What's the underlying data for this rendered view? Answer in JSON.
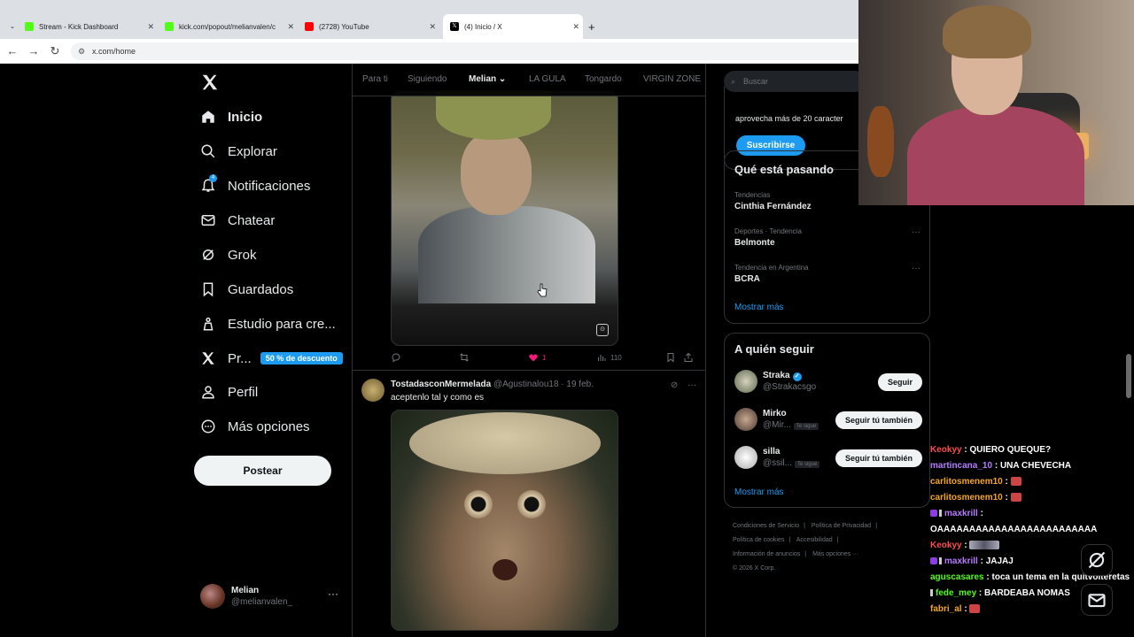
{
  "browser": {
    "tabs": [
      {
        "title": "Stream - Kick Dashboard",
        "color": "#53fc18"
      },
      {
        "title": "kick.com/popout/melianvalen/c",
        "color": "#53fc18"
      },
      {
        "title": "(2728) YouTube",
        "color": "#ff0000"
      },
      {
        "title": "(4) Inicio / X",
        "color": "#000000"
      }
    ],
    "new_tab": "+",
    "url": "x.com/home"
  },
  "nav": {
    "items": [
      {
        "label": "Inicio",
        "icon": "home-icon"
      },
      {
        "label": "Explorar",
        "icon": "search-icon"
      },
      {
        "label": "Notificaciones",
        "icon": "bell-icon",
        "badge": "4"
      },
      {
        "label": "Chatear",
        "icon": "mail-icon"
      },
      {
        "label": "Grok",
        "icon": "grok-icon"
      },
      {
        "label": "Guardados",
        "icon": "bookmark-icon"
      },
      {
        "label": "Estudio para cre...",
        "icon": "studio-icon"
      },
      {
        "label": "Pr...",
        "icon": "x-icon",
        "promo": "50 % de descuento"
      },
      {
        "label": "Perfil",
        "icon": "person-icon"
      },
      {
        "label": "Más opciones",
        "icon": "more-circle-icon"
      }
    ],
    "post_button": "Postear",
    "account": {
      "name": "Melian",
      "handle": "@melianvalen_",
      "more": "···"
    }
  },
  "feed": {
    "tabs": [
      "Para ti",
      "Siguiendo",
      "Melian",
      "LA GULA",
      "Tongardo",
      "VIRGIN ZONE"
    ],
    "selected_tab": "Melian",
    "tweet1": {
      "likes": "1",
      "views": "110",
      "gif_label": "GIF"
    },
    "tweet2": {
      "name": "TostadasconMermelada",
      "handle": "@Agustinalou18",
      "date": "· 19 feb.",
      "text": "aceptenlo tal y como es",
      "more": "···"
    }
  },
  "right": {
    "search_placeholder": "Buscar",
    "premium_text": "aprovecha más de 20 caracter",
    "subscribe": "Suscribirse",
    "trends_title": "Qué está pasando",
    "trends": [
      {
        "context": "Tendencias",
        "name": "Cinthia Fernández"
      },
      {
        "context": "Deportes · Tendencia",
        "name": "Belmonte"
      },
      {
        "context": "Tendencia en Argentina",
        "name": "BCRA"
      }
    ],
    "show_more": "Mostrar más",
    "follow_title": "A quién seguir",
    "follow": [
      {
        "name": "Straka",
        "handle": "@Strakacsgo",
        "button": "Seguir",
        "follows_you": ""
      },
      {
        "name": "Mirko",
        "handle": "@Mir...",
        "button": "Seguir tú también",
        "follows_you": "Te sigue"
      },
      {
        "name": "silla",
        "handle": "@ssil...",
        "button": "Seguir tú también",
        "follows_you": "Te sigue"
      }
    ],
    "footer": [
      "Condiciones de Servicio",
      "|",
      "Política de Privacidad",
      "|",
      "Política de cookies",
      "|",
      "Accesibilidad",
      "|",
      "Información de anuncios",
      "|",
      "Más opciones ···",
      "© 2026 X Corp."
    ]
  },
  "chat": [
    {
      "user": "Keokyy",
      "color": "#ff4d4d",
      "msg": "QUIERO QUEQUE?"
    },
    {
      "user": "martincana_10",
      "color": "#b57cff",
      "msg": "UNA CHEVECHA"
    },
    {
      "user": "carlitosmenem10",
      "color": "#f5a623",
      "msg": ""
    },
    {
      "user": "carlitosmenem10",
      "color": "#f5a623",
      "msg": ""
    },
    {
      "user": "maxkrill",
      "color": "#b57cff",
      "msg": ""
    },
    {
      "user": "",
      "color": "#ffffff",
      "msg": "OAAAAAAAAAAAAAAAAAAAAAAAAA"
    },
    {
      "user": "Keokyy",
      "color": "#ff4d4d",
      "msg": ""
    },
    {
      "user": "maxkrill",
      "color": "#b57cff",
      "msg": "JAJAJ"
    },
    {
      "user": "aguscasares",
      "color": "#53fc18",
      "msg": "toca un tema en la quitvolteretas"
    },
    {
      "user": "fede_mey",
      "color": "#53fc18",
      "msg": "BARDEABA NOMAS"
    },
    {
      "user": "fabri_al",
      "color": "#f5a623",
      "msg": ""
    }
  ]
}
